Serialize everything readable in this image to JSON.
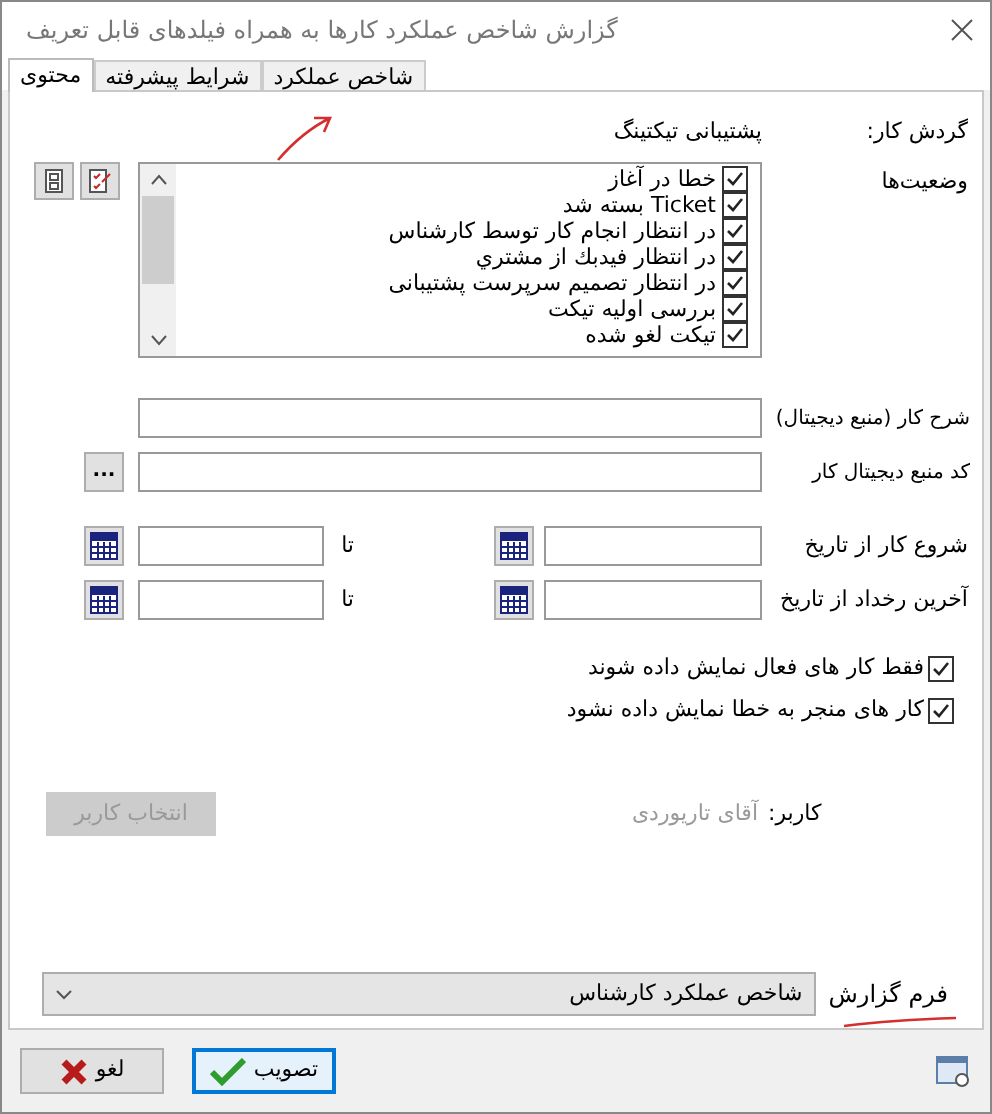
{
  "window": {
    "title": "گزارش شاخص عملکرد کارها به همراه فیلدهای قابل تعریف"
  },
  "tabs": [
    {
      "label": "شاخص عملکرد",
      "selected": false
    },
    {
      "label": "شرایط پیشرفته",
      "selected": false
    },
    {
      "label": "محتوی",
      "selected": true
    }
  ],
  "workflow": {
    "label": "گردش کار:",
    "value": "پشتیبانی تیکتینگ"
  },
  "statuses": {
    "label": "وضعیت‌ها",
    "items": [
      {
        "label": "خطا در آغاز",
        "checked": true
      },
      {
        "label": "Ticket بسته شد",
        "checked": true
      },
      {
        "label": "در انتظار انجام کار توسط کارشناس",
        "checked": true
      },
      {
        "label": "در انتظار فیدبك از مشتري",
        "checked": true
      },
      {
        "label": "در انتظار تصمیم سرپرست پشتیبانی",
        "checked": true
      },
      {
        "label": "بررسی اولیه تیکت",
        "checked": true
      },
      {
        "label": "تیکت لغو شده",
        "checked": true
      }
    ]
  },
  "fields": [
    {
      "label": "شرح کار (منبع دیجیتال)",
      "kind": "text"
    },
    {
      "label": "کد منبع دیجیتال کار",
      "kind": "lookup",
      "button_text": "..."
    }
  ],
  "date_ranges": [
    {
      "label": "شروع کار از تاریخ",
      "to": "تا"
    },
    {
      "label": "آخرین رخداد از تاریخ",
      "to": "تا"
    }
  ],
  "options": [
    {
      "label": "فقط کار های فعال نمایش داده شوند",
      "checked": true
    },
    {
      "label": "کار های منجر به خطا نمایش داده نشود",
      "checked": true
    }
  ],
  "user": {
    "label": "کاربر:",
    "value": "آقای تاریوردی",
    "button": {
      "label": "انتخاب کاربر",
      "disabled": true
    }
  },
  "report_form": {
    "label": "فرم گزارش",
    "value": "شاخص عملکرد کارشناس"
  },
  "buttons": [
    {
      "label": "تصویب",
      "kind": "ok",
      "focused": true
    },
    {
      "label": "لغو",
      "kind": "cancel",
      "focused": false
    }
  ]
}
